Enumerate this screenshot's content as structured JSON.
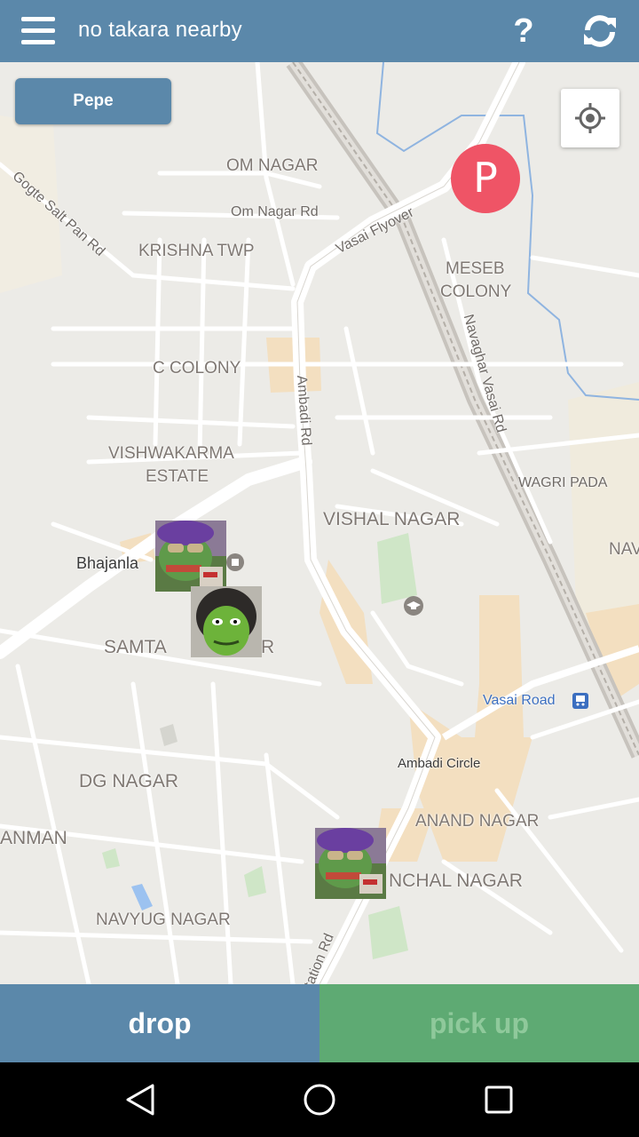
{
  "header": {
    "title": "no takara nearby",
    "help_label": "?"
  },
  "map": {
    "chip_label": "Pepe",
    "marker_label": "P",
    "areas": {
      "om_nagar": "OM NAGAR",
      "om_nagar_rd": "Om Nagar Rd",
      "gogte": "Gogte Salt Pan Rd",
      "vasai_flyover": "Vasai Flyover",
      "krishna_twp": "KRISHNA TWP",
      "meseb_1": "MESEB",
      "meseb_2": "COLONY",
      "navaghar": "Navaghar Vasai Rd",
      "c_colony": "C COLONY",
      "ambadi_rd": "Ambadi Rd",
      "vishwakarma_1": "VISHWAKARMA",
      "vishwakarma_2": "ESTATE",
      "wagri_pada": "WAGRI PADA",
      "vishal_nagar": "VISHAL NAGAR",
      "nav_edge": "NAV",
      "bhajanla": "Bhajanla",
      "samta_left": "SAMTA",
      "samta_right": "R",
      "vasai_road": "Vasai Road",
      "ambadi_circle": "Ambadi Circle",
      "dg_nagar": "DG NAGAR",
      "anand_nagar": "ANAND NAGAR",
      "anman": "ANMAN",
      "nchal_nagar": "NCHAL NAGAR",
      "navyug_nagar": "NAVYUG NAGAR",
      "station_rd": "tation Rd"
    },
    "icons": {
      "locate": "crosshair-icon",
      "train": "train-station-icon",
      "school": "school-icon",
      "shop": "shop-icon"
    }
  },
  "bottom": {
    "drop_label": "drop",
    "pickup_label": "pick up"
  },
  "colors": {
    "primary": "#5b88aa",
    "secondary": "#5eaa73",
    "marker": "#ef5466"
  }
}
